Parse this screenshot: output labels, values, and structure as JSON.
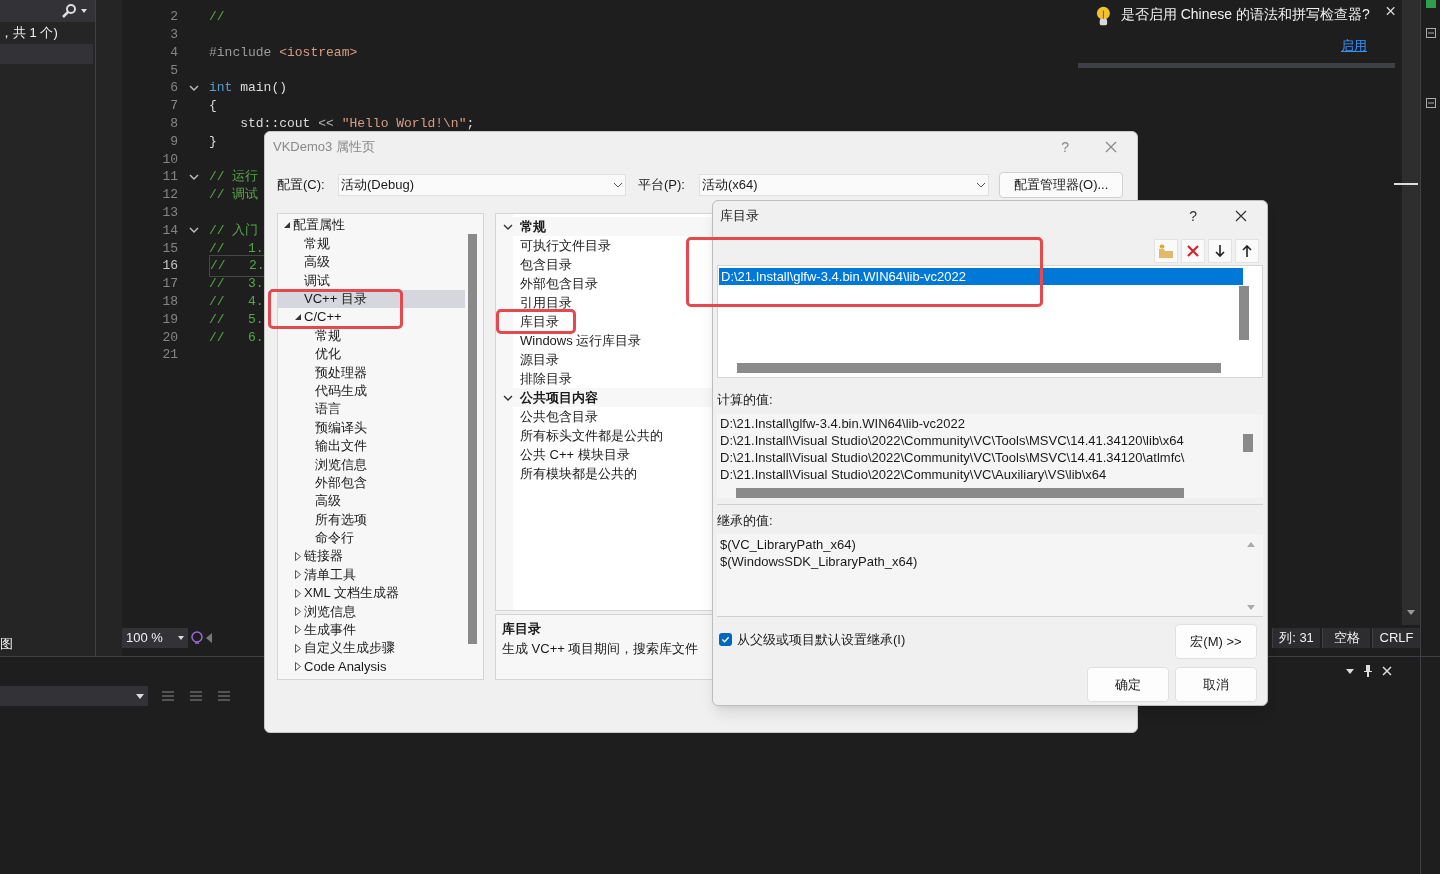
{
  "sidebar": {
    "status_text": "，共 1 个)",
    "footer_text": "图"
  },
  "editor": {
    "lines": [
      {
        "number": "2",
        "fold": false,
        "current": false,
        "tokens": [
          {
            "kind": "comment",
            "text": "//"
          }
        ]
      },
      {
        "number": "3",
        "fold": false,
        "current": false
      },
      {
        "number": "4",
        "fold": false,
        "current": false,
        "tokens": [
          {
            "kind": "preproc",
            "text": "#include "
          },
          {
            "kind": "string",
            "text": "<iostream>"
          }
        ]
      },
      {
        "number": "5",
        "fold": false,
        "current": false
      },
      {
        "number": "6",
        "fold": true,
        "current": false,
        "tokens": [
          {
            "kind": "keyword",
            "text": "int"
          },
          {
            "kind": "plain",
            "text": " main()"
          }
        ]
      },
      {
        "number": "7",
        "fold": false,
        "current": false,
        "tokens": [
          {
            "kind": "plain",
            "text": "{"
          }
        ]
      },
      {
        "number": "8",
        "fold": false,
        "current": false,
        "tokens": [
          {
            "kind": "plain",
            "text": "    std::cout "
          },
          {
            "kind": "operator",
            "text": "<<"
          },
          {
            "kind": "string",
            "text": " \"Hello World!\\n\""
          },
          {
            "kind": "plain",
            "text": ";"
          }
        ]
      },
      {
        "number": "9",
        "fold": false,
        "current": false,
        "tokens": [
          {
            "kind": "plain",
            "text": "}"
          }
        ]
      },
      {
        "number": "10",
        "fold": false,
        "current": false
      },
      {
        "number": "11",
        "fold": true,
        "current": false,
        "tokens": [
          {
            "kind": "comment",
            "text": "// 运行"
          }
        ]
      },
      {
        "number": "12",
        "fold": false,
        "current": false,
        "tokens": [
          {
            "kind": "comment",
            "text": "// 调试"
          }
        ]
      },
      {
        "number": "13",
        "fold": false,
        "current": false
      },
      {
        "number": "14",
        "fold": true,
        "current": false,
        "tokens": [
          {
            "kind": "comment",
            "text": "// 入门"
          }
        ]
      },
      {
        "number": "15",
        "fold": false,
        "current": false,
        "tokens": [
          {
            "kind": "comment",
            "text": "//   1."
          }
        ]
      },
      {
        "number": "16",
        "fold": false,
        "current": true,
        "tokens": [
          {
            "kind": "comment",
            "text": "//   2."
          }
        ]
      },
      {
        "number": "17",
        "fold": false,
        "current": false,
        "tokens": [
          {
            "kind": "comment",
            "text": "//   3."
          }
        ]
      },
      {
        "number": "18",
        "fold": false,
        "current": false,
        "tokens": [
          {
            "kind": "comment",
            "text": "//   4."
          }
        ]
      },
      {
        "number": "19",
        "fold": false,
        "current": false,
        "tokens": [
          {
            "kind": "comment",
            "text": "//   5."
          }
        ]
      },
      {
        "number": "20",
        "fold": false,
        "current": false,
        "tokens": [
          {
            "kind": "comment",
            "text": "//   6."
          }
        ]
      },
      {
        "number": "21",
        "fold": false,
        "current": false
      }
    ],
    "zoom": "100 %",
    "status": [
      "列: 31",
      "空格",
      "CRLF"
    ]
  },
  "notification": {
    "message": "是否启用 Chinese 的语法和拼写检查器?",
    "link": "启用"
  },
  "property_dialog": {
    "title": "VKDemo3 属性页",
    "help_button": "?",
    "config_label": "配置(C):",
    "config_value": "活动(Debug)",
    "platform_label": "平台(P):",
    "platform_value": "活动(x64)",
    "manager_button": "配置管理器(O)...",
    "tree": [
      {
        "label": "配置属性",
        "expanded": true,
        "selected": false,
        "children": [
          {
            "label": "常规",
            "selected": false
          },
          {
            "label": "高级",
            "selected": false
          },
          {
            "label": "调试",
            "selected": false
          },
          {
            "label": "VC++ 目录",
            "selected": true
          },
          {
            "label": "C/C++",
            "expanded": true,
            "selected": false,
            "children": [
              {
                "label": "常规",
                "selected": false
              },
              {
                "label": "优化",
                "selected": false
              },
              {
                "label": "预处理器",
                "selected": false
              },
              {
                "label": "代码生成",
                "selected": false
              },
              {
                "label": "语言",
                "selected": false
              },
              {
                "label": "预编译头",
                "selected": false
              },
              {
                "label": "输出文件",
                "selected": false
              },
              {
                "label": "浏览信息",
                "selected": false
              },
              {
                "label": "外部包含",
                "selected": false
              },
              {
                "label": "高级",
                "selected": false
              },
              {
                "label": "所有选项",
                "selected": false
              },
              {
                "label": "命令行",
                "selected": false
              }
            ]
          },
          {
            "label": "链接器",
            "expanded": false,
            "selected": false
          },
          {
            "label": "清单工具",
            "expanded": false,
            "selected": false
          },
          {
            "label": "XML 文档生成器",
            "expanded": false,
            "selected": false
          },
          {
            "label": "浏览信息",
            "expanded": false,
            "selected": false
          },
          {
            "label": "生成事件",
            "expanded": false,
            "selected": false
          },
          {
            "label": "自定义生成步骤",
            "expanded": false,
            "selected": false
          },
          {
            "label": "Code Analysis",
            "expanded": false,
            "selected": false
          }
        ]
      }
    ],
    "grid": [
      {
        "group": "常规",
        "expanded": true,
        "items": [
          "可执行文件目录",
          "包含目录",
          "外部包含目录",
          "引用目录",
          "库目录",
          "Windows 运行库目录",
          "源目录",
          "排除目录"
        ]
      },
      {
        "group": "公共项目内容",
        "expanded": true,
        "items": [
          "公共包含目录",
          "所有标头文件都是公共的",
          "公共 C++ 模块目录",
          "所有模块都是公共的"
        ]
      }
    ],
    "description": {
      "title": "库目录",
      "text": "生成 VC++ 项目期间，搜索库文件"
    }
  },
  "library_dialog": {
    "title": "库目录",
    "help_button": "?",
    "entries": [
      {
        "text": "D:\\21.Install\\glfw-3.4.bin.WIN64\\lib-vc2022",
        "selected": true
      }
    ],
    "computed_label": "计算的值:",
    "computed_values": [
      "D:\\21.Install\\glfw-3.4.bin.WIN64\\lib-vc2022",
      "D:\\21.Install\\Visual Studio\\2022\\Community\\VC\\Tools\\MSVC\\14.41.34120\\lib\\x64",
      "D:\\21.Install\\Visual Studio\\2022\\Community\\VC\\Tools\\MSVC\\14.41.34120\\atlmfc\\",
      "D:\\21.Install\\Visual Studio\\2022\\Community\\VC\\Auxiliary\\VS\\lib\\x64"
    ],
    "inherited_label": "继承的值:",
    "inherited_values": [
      "$(VC_LibraryPath_x64)",
      "$(WindowsSDK_LibraryPath_x64)"
    ],
    "inherit_checkbox": {
      "label": "从父级或项目默认设置继承(I)",
      "checked": true
    },
    "macro_button": "宏(M) >>",
    "buttons": [
      "确定",
      "取消"
    ]
  }
}
